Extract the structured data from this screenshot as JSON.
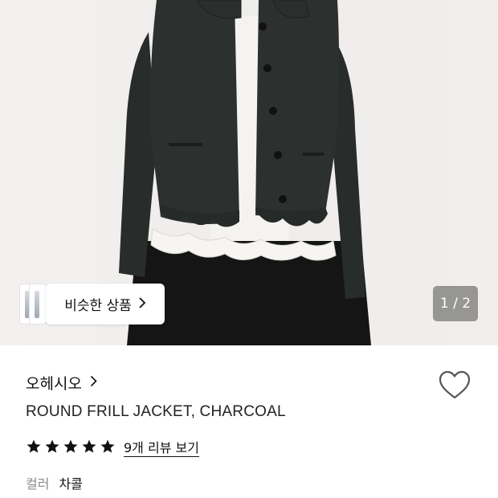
{
  "gallery": {
    "similar_products_label": "비슷한 상품",
    "page_counter": "1 / 2"
  },
  "product": {
    "brand": "오헤시오",
    "name": "ROUND FRILL JACKET, CHARCOAL",
    "rating_stars": 5,
    "review_link": "9개 리뷰 보기",
    "option": {
      "label": "컬러",
      "value": "차콜"
    }
  },
  "icons": {
    "brand_chevron": "chevron-right-icon",
    "similar_chevron": "chevron-right-icon",
    "wishlist": "heart-outline-icon",
    "star": "star-filled-icon"
  },
  "colors": {
    "jacket": "#2b2f2d",
    "blouse": "#f4f2ef",
    "skirt": "#161616",
    "background": "#efedec"
  }
}
